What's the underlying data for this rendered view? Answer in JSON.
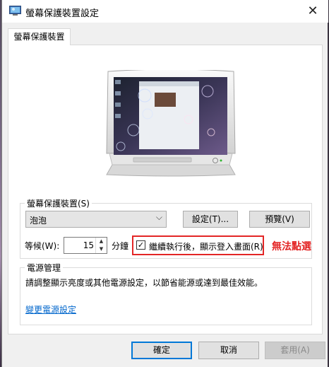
{
  "window": {
    "title": "螢幕保護裝置設定",
    "close_glyph": "✕"
  },
  "tabs": [
    "螢幕保護裝置"
  ],
  "screensaver": {
    "group_label": "螢幕保護裝置(S)",
    "selected": "泡泡",
    "settings_button": "設定(T)...",
    "preview_button": "預覽(V)",
    "wait_label": "等候(W):",
    "wait_value": "15",
    "minutes_label": "分鐘",
    "resume_checkbox_label": "繼續執行後，顯示登入畫面(R)",
    "resume_checked": true,
    "annotation": "無法點選"
  },
  "power": {
    "group_label": "電源管理",
    "description": "請調整顯示亮度或其他電源設定，以節省能源或達到最佳效能。",
    "link": "變更電源設定"
  },
  "buttons": {
    "ok": "確定",
    "cancel": "取消",
    "apply": "套用(A)"
  },
  "colors": {
    "highlight_red": "#e32626",
    "link_blue": "#0066cc",
    "accent": "#0078d7"
  }
}
